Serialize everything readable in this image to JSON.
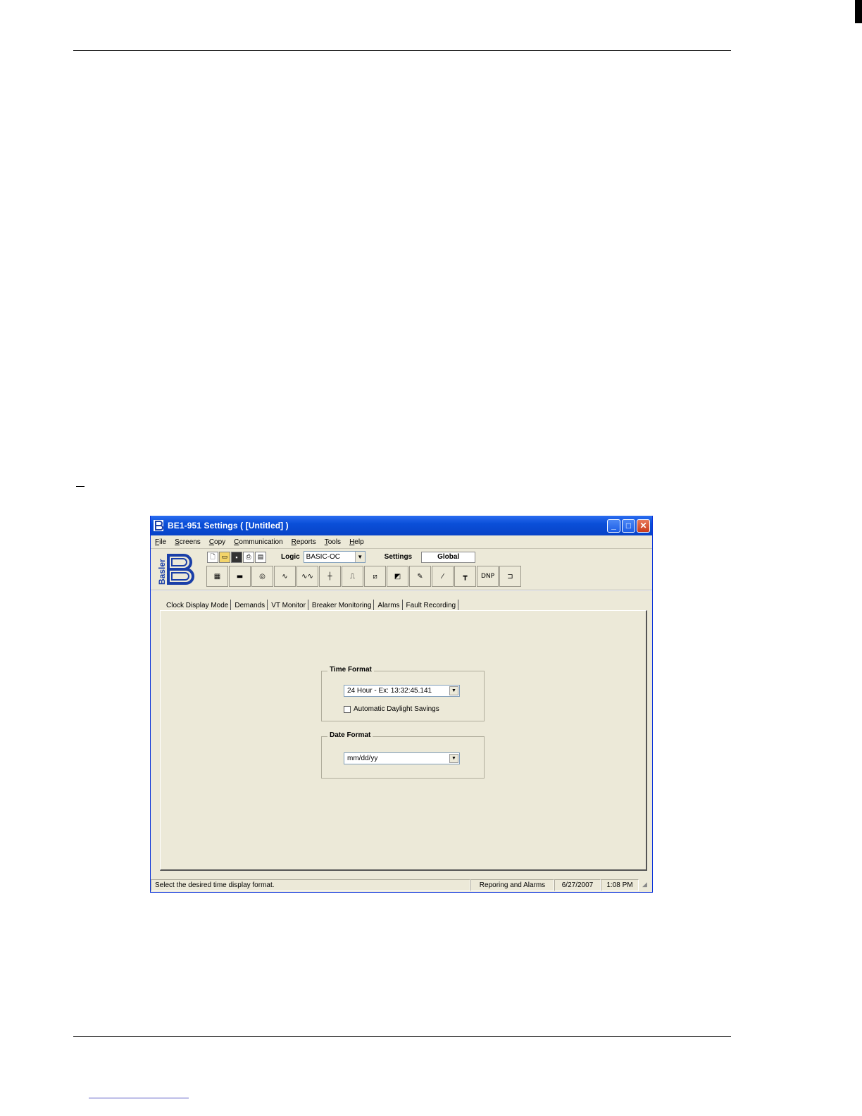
{
  "window": {
    "title": "BE1-951 Settings    ( [Untitled] )",
    "minimize_glyph": "_",
    "maximize_glyph": "□",
    "close_glyph": "✕"
  },
  "menu": [
    "File",
    "Screens",
    "Copy",
    "Communication",
    "Reports",
    "Tools",
    "Help"
  ],
  "toolbar": {
    "logo_text": "Basler",
    "logic_label": "Logic",
    "logic_value": "BASIC-OC",
    "settings_label": "Settings",
    "settings_value": "Global",
    "dnp_label": "DNP"
  },
  "tabs": [
    "Clock Display Mode",
    "Demands",
    "VT Monitor",
    "Breaker Monitoring",
    "Alarms",
    "Fault Recording"
  ],
  "time_format": {
    "legend": "Time Format",
    "value": "24 Hour - Ex: 13:32:45.141",
    "checkbox_label": "Automatic Daylight Savings"
  },
  "date_format": {
    "legend": "Date Format",
    "value": "mm/dd/yy"
  },
  "status": {
    "message": "Select the desired time display format.",
    "section": "Reporing and Alarms",
    "date": "6/27/2007",
    "time": "1:08 PM"
  },
  "colors": {
    "titlebar": "#0a4fd8",
    "window_face": "#ece9d8",
    "logo_blue": "#1a3fa8"
  }
}
